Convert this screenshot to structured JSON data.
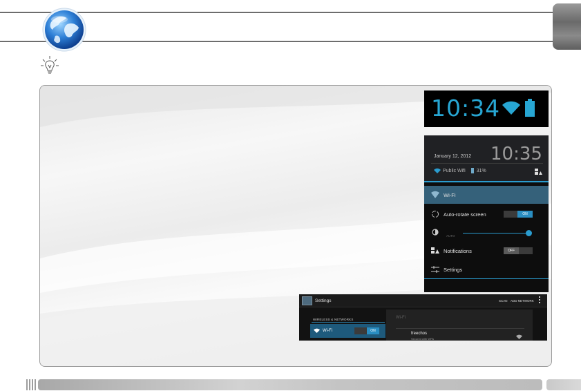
{
  "colors": {
    "rule": "#6d6d6d",
    "accent_blue": "#27a6d3",
    "android_dark": "#0d0d0d",
    "wifi_highlight": "#35617a"
  },
  "icons": {
    "header": "globe-icon",
    "tip": "lightbulb-icon",
    "tab": "chapter-tab"
  },
  "status_bar": {
    "time": "10:34",
    "icons": [
      "wifi-signal-icon",
      "battery-icon"
    ]
  },
  "notification_shade": {
    "date": "January 12, 2012",
    "time": "10:35",
    "network_name": "Public Wifi",
    "battery_level": "31%",
    "quick_settings": [
      {
        "label": "Wi-Fi",
        "icon": "wifi-icon"
      },
      {
        "label": "Auto-rotate screen",
        "icon": "rotate-icon",
        "toggle": "ON"
      },
      {
        "label": "",
        "icon": "brightness-icon",
        "sublabel": "AUTO",
        "slider_fraction": 0.97
      },
      {
        "label": "Notifications",
        "icon": "notifications-icon",
        "toggle": "OFF"
      },
      {
        "label": "Settings",
        "icon": "settings-sliders-icon"
      }
    ]
  },
  "settings_screen": {
    "title": "Settings",
    "actions": [
      "SCAN",
      "ADD NETWORK"
    ],
    "section_header": "WIRELESS & NETWORKS",
    "wifi_label": "Wi-Fi",
    "wifi_toggle": "ON",
    "pane_title": "Wi-Fi",
    "network": {
      "name": "freechos",
      "status": "Secured with WPA"
    }
  }
}
